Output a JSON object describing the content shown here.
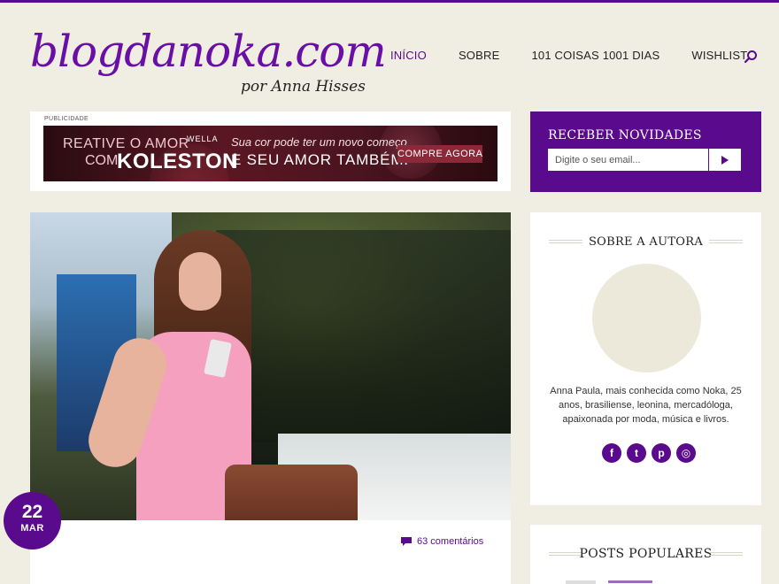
{
  "brand": {
    "logo_text": "blogdanoka.com",
    "logo_subtitle": "por Anna Hisses",
    "accent_color": "#5a0a8c",
    "background_color": "#f0eee2"
  },
  "nav": {
    "items": [
      {
        "label": "INÍCIO",
        "active": true
      },
      {
        "label": "SOBRE",
        "active": false
      },
      {
        "label": "101 COISAS 1001 DIAS",
        "active": false
      },
      {
        "label": "WISHLIST",
        "active": false
      }
    ],
    "search_icon": "search-icon"
  },
  "ad": {
    "label": "PUBLICIDADE",
    "headline_line1": "REATIVE O AMOR",
    "headline_line2": "COM",
    "brand": "KOLESTON",
    "brand_maker": "WELLA",
    "copy_line1": "Sua cor pode ter um novo começo",
    "copy_line2": "E SEU AMOR TAMBÉM.",
    "cta": "COMPRE AGORA"
  },
  "newsletter": {
    "title": "RECEBER NOVIDADES",
    "placeholder": "Digite o seu email...",
    "submit_icon": "play-arrow-icon"
  },
  "post": {
    "date_day": "22",
    "date_month": "MAR",
    "comments_label": "63 comentários",
    "comments_icon": "comment-icon"
  },
  "about": {
    "title": "SOBRE A AUTORA",
    "bio": "Anna Paula, mais conhecida como Noka, 25 anos, brasiliense, leonina, mercadóloga, apaixonada por moda, música e livros.",
    "socials": [
      {
        "name": "facebook-icon",
        "glyph": "f"
      },
      {
        "name": "twitter-icon",
        "glyph": "t"
      },
      {
        "name": "pinterest-icon",
        "glyph": "p"
      },
      {
        "name": "instagram-icon",
        "glyph": "◎"
      }
    ]
  },
  "popular": {
    "title": "POSTS POPULARES"
  }
}
